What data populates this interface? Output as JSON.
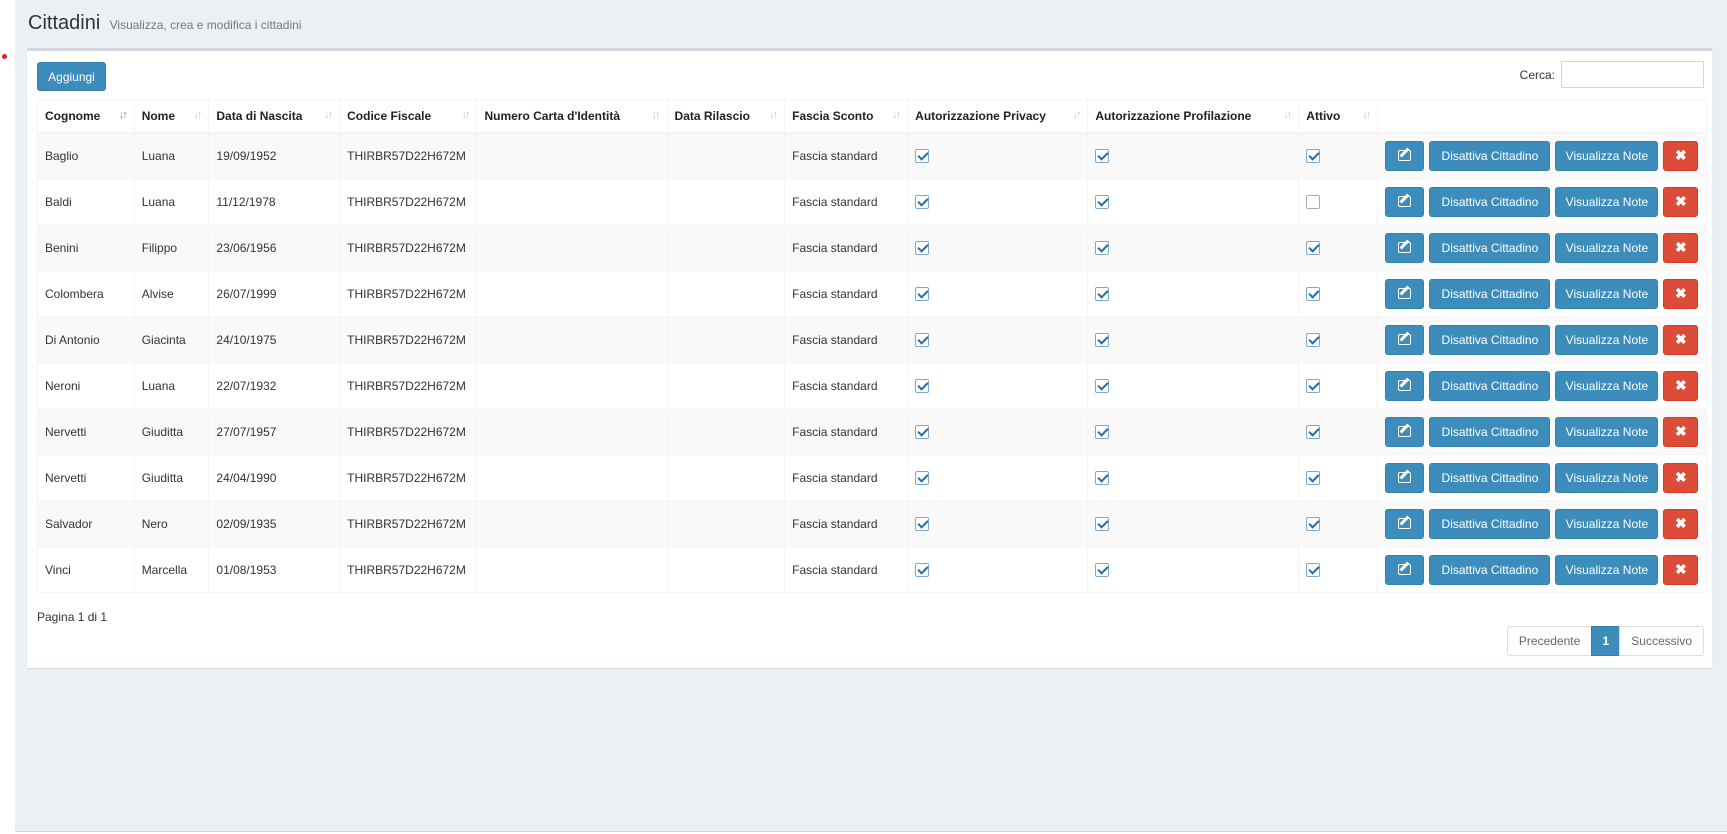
{
  "header": {
    "title": "Cittadini",
    "subtitle": "Visualizza, crea e modifica i cittadini"
  },
  "toolbar": {
    "add_label": "Aggiungi",
    "search_label": "Cerca:",
    "search_value": ""
  },
  "table": {
    "columns": [
      "Cognome",
      "Nome",
      "Data di Nascita",
      "Codice Fiscale",
      "Numero Carta d'Identità",
      "Data Rilascio",
      "Fascia Sconto",
      "Autorizzazione Privacy",
      "Autorizzazione Profilazione",
      "Attivo"
    ],
    "sorted_column": "Cognome",
    "rows": [
      {
        "cognome": "Baglio",
        "nome": "Luana",
        "nascita": "19/09/1952",
        "cf": "THIRBR57D22H672M",
        "carta": "",
        "rilascio": "",
        "fascia": "Fascia standard",
        "privacy": true,
        "profilazione": true,
        "attivo": true
      },
      {
        "cognome": "Baldi",
        "nome": "Luana",
        "nascita": "11/12/1978",
        "cf": "THIRBR57D22H672M",
        "carta": "",
        "rilascio": "",
        "fascia": "Fascia standard",
        "privacy": true,
        "profilazione": true,
        "attivo": false
      },
      {
        "cognome": "Benini",
        "nome": "Filippo",
        "nascita": "23/06/1956",
        "cf": "THIRBR57D22H672M",
        "carta": "",
        "rilascio": "",
        "fascia": "Fascia standard",
        "privacy": true,
        "profilazione": true,
        "attivo": true
      },
      {
        "cognome": "Colombera",
        "nome": "Alvise",
        "nascita": "26/07/1999",
        "cf": "THIRBR57D22H672M",
        "carta": "",
        "rilascio": "",
        "fascia": "Fascia standard",
        "privacy": true,
        "profilazione": true,
        "attivo": true
      },
      {
        "cognome": "Di Antonio",
        "nome": "Giacinta",
        "nascita": "24/10/1975",
        "cf": "THIRBR57D22H672M",
        "carta": "",
        "rilascio": "",
        "fascia": "Fascia standard",
        "privacy": true,
        "profilazione": true,
        "attivo": true
      },
      {
        "cognome": "Neroni",
        "nome": "Luana",
        "nascita": "22/07/1932",
        "cf": "THIRBR57D22H672M",
        "carta": "",
        "rilascio": "",
        "fascia": "Fascia standard",
        "privacy": true,
        "profilazione": true,
        "attivo": true
      },
      {
        "cognome": "Nervetti",
        "nome": "Giuditta",
        "nascita": "27/07/1957",
        "cf": "THIRBR57D22H672M",
        "carta": "",
        "rilascio": "",
        "fascia": "Fascia standard",
        "privacy": true,
        "profilazione": true,
        "attivo": true
      },
      {
        "cognome": "Nervetti",
        "nome": "Giuditta",
        "nascita": "24/04/1990",
        "cf": "THIRBR57D22H672M",
        "carta": "",
        "rilascio": "",
        "fascia": "Fascia standard",
        "privacy": true,
        "profilazione": true,
        "attivo": true
      },
      {
        "cognome": "Salvador",
        "nome": "Nero",
        "nascita": "02/09/1935",
        "cf": "THIRBR57D22H672M",
        "carta": "",
        "rilascio": "",
        "fascia": "Fascia standard",
        "privacy": true,
        "profilazione": true,
        "attivo": true
      },
      {
        "cognome": "Vinci",
        "nome": "Marcella",
        "nascita": "01/08/1953",
        "cf": "THIRBR57D22H672M",
        "carta": "",
        "rilascio": "",
        "fascia": "Fascia standard",
        "privacy": true,
        "profilazione": true,
        "attivo": true
      }
    ],
    "actions": {
      "edit_icon": "edit-icon",
      "deactivate_label": "Disattiva Cittadino",
      "notes_label": "Visualizza Note",
      "delete_glyph": "✖"
    }
  },
  "footer": {
    "page_info": "Pagina 1 di 1",
    "pagination": {
      "prev_label": "Precedente",
      "current_page": "1",
      "next_label": "Successivo"
    }
  },
  "colors": {
    "primary": "#3c8dbc",
    "danger": "#dd4b39",
    "background": "#ecf0f5"
  }
}
